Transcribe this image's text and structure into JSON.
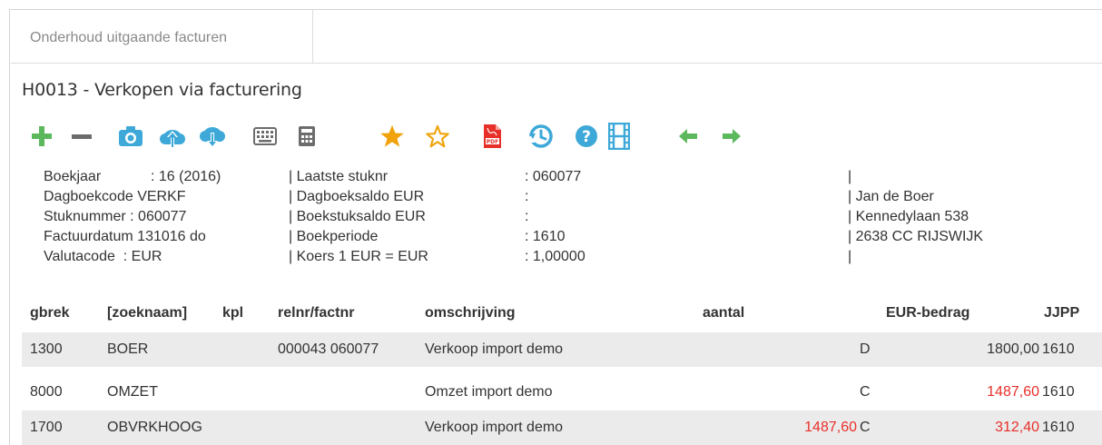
{
  "tab": {
    "label": "Onderhoud uitgaande facturen"
  },
  "page": {
    "title": "H0013 - Verkopen via facturering"
  },
  "colors": {
    "green": "#5cb85c",
    "blue": "#3ea9d8",
    "orange": "#f0a30a",
    "red": "#e8302a",
    "gray": "#6c6c6c"
  },
  "toolbar": [
    {
      "id": "add",
      "icon": "plus-icon"
    },
    {
      "id": "remove",
      "icon": "minus-icon"
    },
    {
      "id": "snapshot",
      "icon": "camera-icon"
    },
    {
      "id": "upload",
      "icon": "cloud-upload-icon"
    },
    {
      "id": "download",
      "icon": "cloud-download-icon"
    },
    {
      "id": "keyboard",
      "icon": "keyboard-icon"
    },
    {
      "id": "calculator",
      "icon": "calculator-icon"
    },
    {
      "id": "favorite",
      "icon": "star-filled-icon"
    },
    {
      "id": "favorite-outline",
      "icon": "star-outline-icon"
    },
    {
      "id": "pdf",
      "icon": "pdf-icon"
    },
    {
      "id": "refresh",
      "icon": "clock-refresh-icon"
    },
    {
      "id": "help",
      "icon": "question-icon"
    },
    {
      "id": "video",
      "icon": "film-icon"
    },
    {
      "id": "previous",
      "icon": "arrow-left-icon"
    },
    {
      "id": "next",
      "icon": "arrow-right-icon"
    }
  ],
  "info": {
    "left": [
      {
        "label": "Boekjaar",
        "value": ": 16 (2016)"
      },
      {
        "label": "Dagboekcode",
        "value": "VERKF"
      },
      {
        "label": "Stuknummer",
        "value": ": 060077"
      },
      {
        "label": "Factuurdatum",
        "value": "131016 do"
      },
      {
        "label": "Valutacode",
        "value": ": EUR"
      }
    ],
    "middle": [
      {
        "label": "| Laatste stuknr",
        "value": ": 060077"
      },
      {
        "label": "| Dagboeksaldo EUR",
        "value": ":"
      },
      {
        "label": "| Boekstuksaldo EUR",
        "value": ":"
      },
      {
        "label": "| Boekperiode",
        "value": ": 1610"
      },
      {
        "label": "| Koers 1 EUR = EUR",
        "value": ": 1,00000"
      }
    ],
    "right": [
      "|",
      "| Jan de Boer",
      "| Kennedylaan 538",
      "| 2638 CC RIJSWIJK",
      "|"
    ]
  },
  "table": {
    "headers": {
      "gbrek": "gbrek",
      "zoeknaam": "[zoeknaam]",
      "kpl": "kpl",
      "relnr": "relnr/factnr",
      "omschrijving": "omschrijving",
      "aantal": "aantal",
      "bedrag": "EUR-bedrag",
      "jjpp": "JJPP"
    },
    "rows": [
      {
        "gbrek": "1300",
        "zoeknaam": "BOER",
        "relnr": "000043 060077",
        "omschrijving": "Verkoop import demo",
        "aantal": "",
        "dc": "D",
        "bedrag": "1800,00",
        "jjpp": "1610",
        "bedrag_red": false,
        "aantal_red": false
      },
      {
        "gbrek": "8000",
        "zoeknaam": "OMZET",
        "relnr": "",
        "omschrijving": "Omzet import demo",
        "aantal": "",
        "dc": "C",
        "bedrag": "1487,60",
        "jjpp": "1610",
        "bedrag_red": true,
        "aantal_red": false
      },
      {
        "gbrek": "1700",
        "zoeknaam": "OBVRKHOOG",
        "relnr": "",
        "omschrijving": "Verkoop import demo",
        "aantal": "1487,60",
        "dc": "C",
        "bedrag": "312,40",
        "jjpp": "1610",
        "bedrag_red": true,
        "aantal_red": true
      }
    ]
  }
}
